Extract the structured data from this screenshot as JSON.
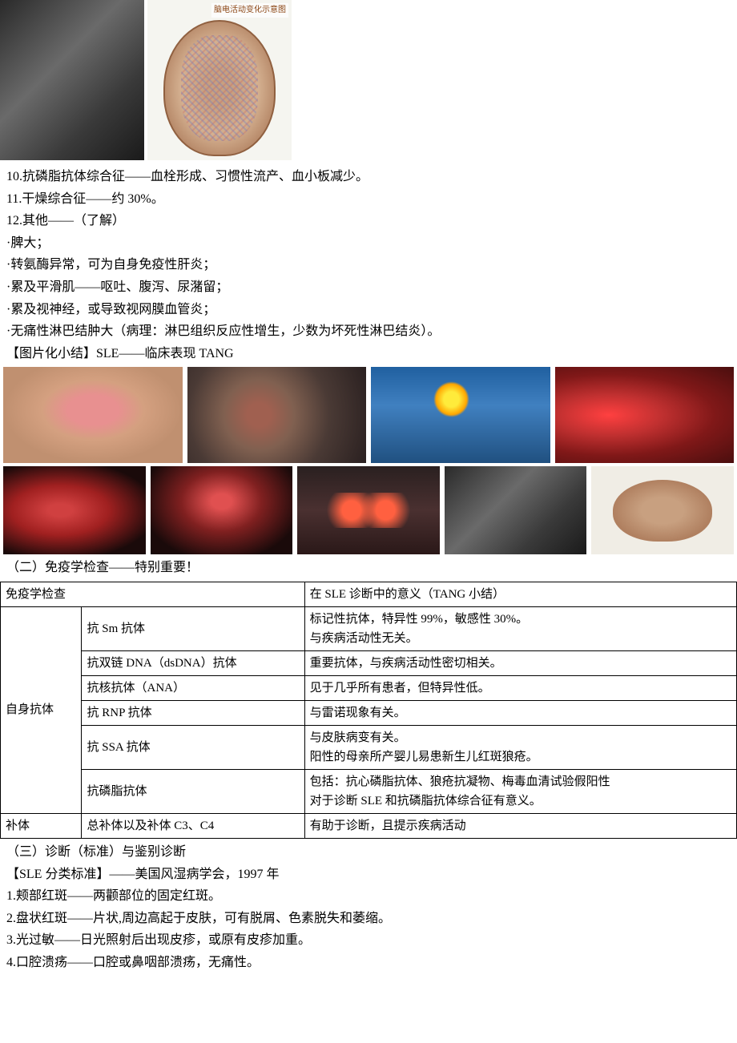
{
  "top_image_labels": {
    "brain_caption": "脑电活动变化示意图"
  },
  "section_a": {
    "item10": "10.抗磷脂抗体综合征——血栓形成、习惯性流产、血小板减少。",
    "item11": "11.干燥综合征——约 30%。",
    "item12": "12.其他——（了解）",
    "bullet1": "·脾大；",
    "bullet2": "·转氨酶异常，可为自身免疫性肝炎；",
    "bullet3": "·累及平滑肌——呕吐、腹泻、尿潴留；",
    "bullet4": "·累及视神经，或导致视网膜血管炎；",
    "bullet5": "·无痛性淋巴结肿大（病理：淋巴组织反应性增生，少数为坏死性淋巴结炎）。",
    "summary_heading": "【图片化小结】SLE——临床表现 TANG"
  },
  "section_b_heading": "（二）免疫学检查——特别重要！",
  "table": {
    "header_col1": "免疫学检查",
    "header_col2": "在 SLE 诊断中的意义（TANG 小结）",
    "group1_label": "自身抗体",
    "group2_label": "补体",
    "rows": [
      {
        "name": "抗 Sm 抗体",
        "meaning_line1": "标记性抗体，特异性 99%，敏感性 30%。",
        "meaning_line2": "与疾病活动性无关。"
      },
      {
        "name": "抗双链 DNA（dsDNA）抗体",
        "meaning": "重要抗体，与疾病活动性密切相关。"
      },
      {
        "name": "抗核抗体（ANA）",
        "meaning": "见于几乎所有患者，但特异性低。"
      },
      {
        "name": "抗 RNP 抗体",
        "meaning": "与雷诺现象有关。"
      },
      {
        "name": "抗 SSA 抗体",
        "meaning_line1": "与皮肤病变有关。",
        "meaning_line2": "阳性的母亲所产婴儿易患新生儿红斑狼疮。"
      },
      {
        "name": "抗磷脂抗体",
        "meaning_line1": "包括：抗心磷脂抗体、狼疮抗凝物、梅毒血清试验假阳性",
        "meaning_line2": "对于诊断 SLE 和抗磷脂抗体综合征有意义。"
      },
      {
        "name": "总补体以及补体 C3、C4",
        "meaning": "有助于诊断，且提示疾病活动"
      }
    ]
  },
  "section_c": {
    "heading": "（三）诊断（标准）与鉴别诊断",
    "classification_heading": "【SLE 分类标准】——美国风湿病学会，1997 年",
    "item1": "1.颊部红斑——两颧部位的固定红斑。",
    "item2": "2.盘状红斑——片状,周边高起于皮肤，可有脱屑、色素脱失和萎缩。",
    "item3": "3.光过敏——日光照射后出现皮疹，或原有皮疹加重。",
    "item4": "4.口腔溃疡——口腔或鼻咽部溃疡，无痛性。"
  }
}
